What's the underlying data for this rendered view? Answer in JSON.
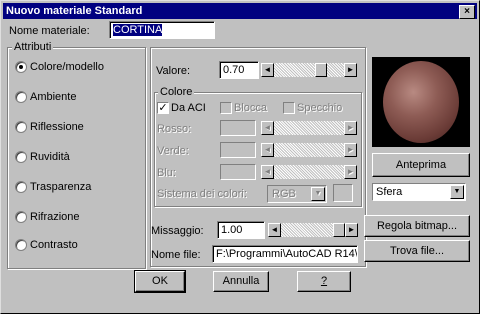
{
  "window": {
    "title": "Nuovo materiale Standard",
    "close_glyph": "×"
  },
  "name": {
    "label": "Nome materiale:",
    "value": "CORTINA"
  },
  "attributes": {
    "title": "Attributi",
    "items": [
      {
        "label": "Colore/modello",
        "selected": true
      },
      {
        "label": "Ambiente",
        "selected": false
      },
      {
        "label": "Riflessione",
        "selected": false
      },
      {
        "label": "Ruvidità",
        "selected": false
      },
      {
        "label": "Trasparenza",
        "selected": false
      },
      {
        "label": "Rifrazione",
        "selected": false
      },
      {
        "label": "Contrasto",
        "selected": false
      }
    ]
  },
  "value": {
    "label": "Valore:",
    "value": "0.70",
    "level": 0.7
  },
  "color": {
    "title": "Colore",
    "by_aci_label": "Da ACI",
    "by_aci_checked": true,
    "lock_label": "Blocca",
    "mirror_label": "Specchio",
    "red_label": "Rosso:",
    "green_label": "Verde:",
    "blue_label": "Blu:",
    "system_label": "Sistema dei colori:",
    "system_value": "RGB"
  },
  "preview": {
    "button": "Anteprima",
    "shape": "Sfera"
  },
  "blend": {
    "label": "Missaggio:",
    "value": "1.00",
    "level": 1.0
  },
  "file": {
    "label": "Nome file:",
    "value": "F:\\Programmi\\AutoCAD R14\\T"
  },
  "buttons": {
    "adjust_bitmap": "Regola bitmap...",
    "find_file": "Trova file...",
    "ok": "OK",
    "cancel": "Annulla",
    "help": "?"
  },
  "icons": {
    "scroll_left": "◄",
    "scroll_right": "►",
    "dropdown": "▼",
    "check": "✓"
  }
}
